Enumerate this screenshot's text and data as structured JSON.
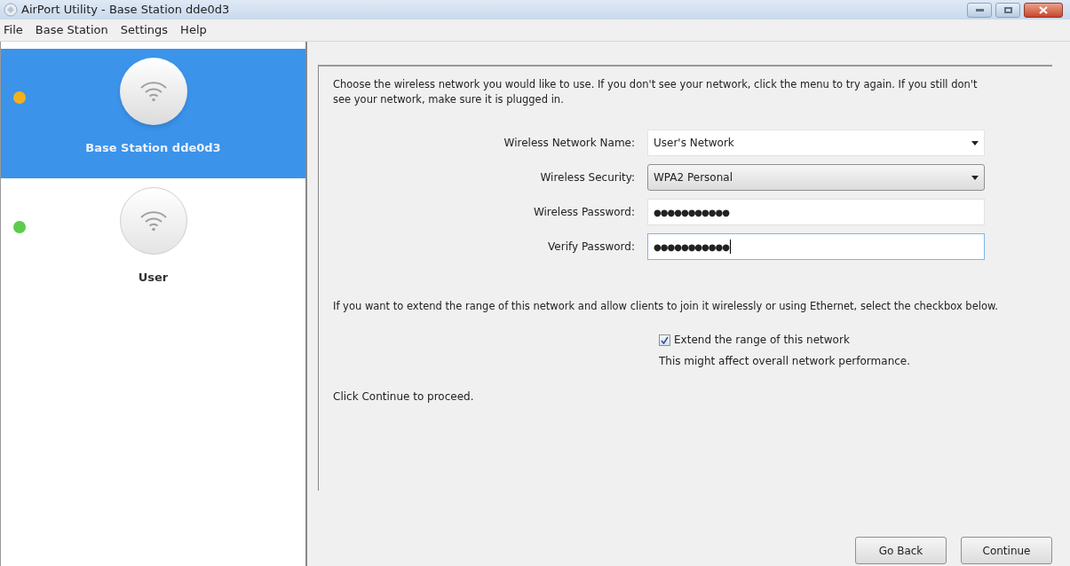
{
  "window": {
    "title": "AirPort Utility - Base Station dde0d3"
  },
  "menu": [
    "File",
    "Base Station",
    "Settings",
    "Help"
  ],
  "sidebar": {
    "items": [
      {
        "name": "Base Station dde0d3",
        "selected": true,
        "color": "#f2b01e"
      },
      {
        "name": "User",
        "selected": false,
        "color": "#5ecb4e"
      }
    ]
  },
  "intro": "Choose the wireless network you would like  to use. If you don't see your network, click the menu to try again. If you still don't see your network, make sure it is plugged in.",
  "fields": [
    {
      "kind": "combo",
      "label": "Wireless Network Name:",
      "value": "User's Network",
      "focused": false
    },
    {
      "kind": "select",
      "label": "Wireless Security:",
      "value": "WPA2 Personal",
      "focused": false
    },
    {
      "kind": "text",
      "label": "Wireless Password:",
      "value": "●●●●●●●●●●●",
      "focused": false
    },
    {
      "kind": "text",
      "label": "Verify Password:",
      "value": "●●●●●●●●●●●",
      "focused": true
    }
  ],
  "extend_text": "If you want to extend the range of this network and allow clients to join it wirelessly or using Ethernet, select the checkbox below.",
  "checkbox": {
    "label": "Extend the range of this network",
    "checked": true,
    "note": "This might affect overall network performance."
  },
  "footer_text": "Click Continue to proceed.",
  "buttons": [
    "Go Back",
    "Continue"
  ]
}
